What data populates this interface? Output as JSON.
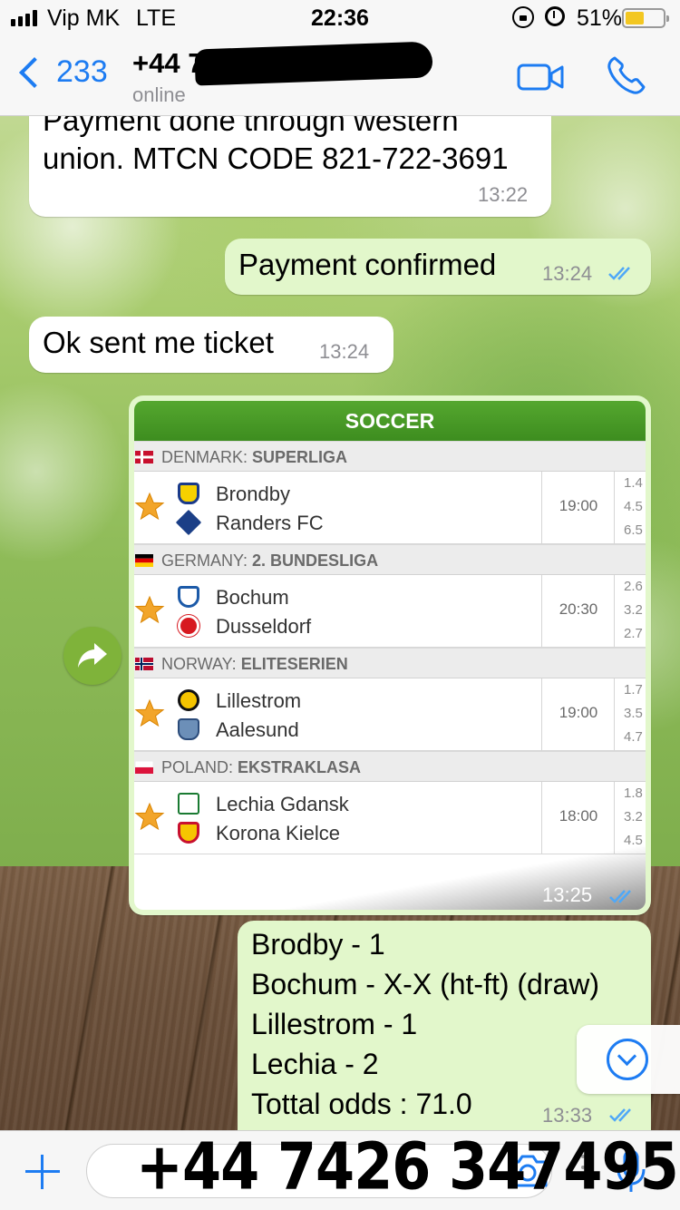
{
  "status_bar": {
    "carrier": "Vip MK",
    "network": "LTE",
    "time": "22:36",
    "battery_percent": "51%",
    "battery_level": 0.51,
    "battery_color": "#f3c721"
  },
  "header": {
    "back_count": "233",
    "contact_name": "+44 7",
    "status": "online",
    "accent": "#1d7cf2"
  },
  "messages": [
    {
      "direction": "in",
      "lines": [
        "Payment done through western",
        "union. MTCN CODE 821-722-3691"
      ],
      "time": "13:22"
    },
    {
      "direction": "out",
      "text": "Payment confirmed",
      "time": "13:24",
      "status": "read"
    },
    {
      "direction": "in",
      "text": "Ok sent me ticket",
      "time": "13:24"
    },
    {
      "direction": "out",
      "type": "image",
      "time": "13:25",
      "status": "read",
      "ticket": {
        "sport": "SOCCER",
        "leagues": [
          {
            "country": "DENMARK:",
            "league": "SUPERLIGA",
            "home": "Brondby",
            "away": "Randers FC",
            "kickoff": "19:00",
            "odds": [
              "1.4",
              "4.5",
              "6.5"
            ]
          },
          {
            "country": "GERMANY:",
            "league": "2. BUNDESLIGA",
            "home": "Bochum",
            "away": "Dusseldorf",
            "kickoff": "20:30",
            "odds": [
              "2.6",
              "3.2",
              "2.7"
            ]
          },
          {
            "country": "NORWAY:",
            "league": "ELITESERIEN",
            "home": "Lillestrom",
            "away": "Aalesund",
            "kickoff": "19:00",
            "odds": [
              "1.7",
              "3.5",
              "4.7"
            ]
          },
          {
            "country": "POLAND:",
            "league": "EKSTRAKLASA",
            "home": "Lechia Gdansk",
            "away": "Korona Kielce",
            "kickoff": "18:00",
            "odds": [
              "1.8",
              "3.2",
              "4.5"
            ]
          }
        ]
      }
    },
    {
      "direction": "out",
      "lines": [
        "Brodby - 1",
        "Bochum - X-X (ht-ft) (draw)",
        "Lillestrom - 1",
        "Lechia - 2",
        "Tottal odds : 71.0"
      ],
      "time": "13:33",
      "status": "read"
    }
  ],
  "overlay_text": "+44 7426 347495",
  "input": {
    "value": "",
    "placeholder": ""
  },
  "colors": {
    "incoming_bubble": "#ffffff",
    "outgoing_bubble": "#e2f7cb",
    "read_ticks": "#4fa8f7",
    "ticket_header": "#3d8d1f"
  }
}
